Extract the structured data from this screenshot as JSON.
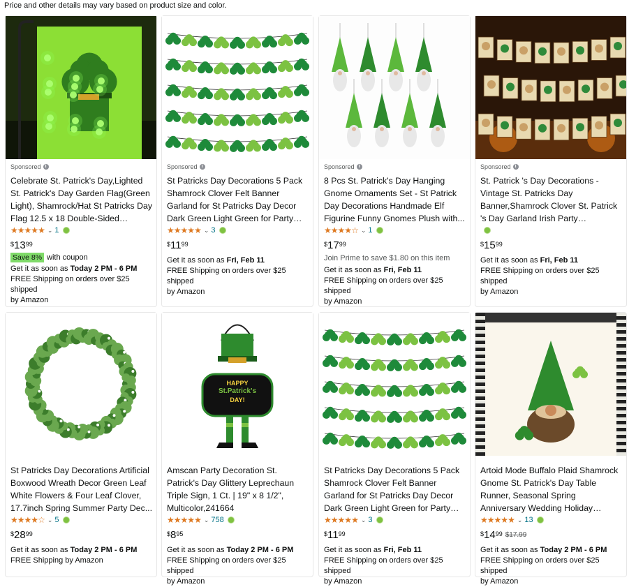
{
  "notice": "Price and other details may vary based on product size and color.",
  "sponsored_label": "Sponsored",
  "info_glyph": "i",
  "star_glyph": "★",
  "chevron_glyph": "⌄",
  "products": [
    {
      "sponsored": true,
      "title": "Celebrate St. Patrick's Day,Lighted St. Patrick's Day Garden Flag(Green Light), Shamrock/Hat St Patricks Day Flag 12.5 x 18 Double-Sided Displa...",
      "rating": 5,
      "rating_count": "1",
      "prime": true,
      "price_currency": "$",
      "price_whole": "13",
      "price_fraction": "99",
      "was_price": "",
      "coupon_badge": "Save 8%",
      "coupon_text": "with coupon",
      "extra_line": "",
      "delivery_prefix": "Get it as soon as ",
      "delivery_date": "Today 2 PM - 6 PM",
      "shipping": "FREE Shipping on orders over $25 shipped",
      "shipping_by": "by Amazon",
      "image_kind": "flag"
    },
    {
      "sponsored": true,
      "title": "St Patricks Day Decorations 5 Pack Shamrock Clover Felt Banner Garland for St Patricks Day Decor Dark Green Light Green for Party Home Store",
      "rating": 5,
      "rating_count": "3",
      "prime": true,
      "price_currency": "$",
      "price_whole": "11",
      "price_fraction": "99",
      "was_price": "",
      "coupon_badge": "",
      "coupon_text": "",
      "extra_line": "",
      "delivery_prefix": "Get it as soon as ",
      "delivery_date": "Fri, Feb 11",
      "shipping": "FREE Shipping on orders over $25 shipped",
      "shipping_by": "by Amazon",
      "image_kind": "garland"
    },
    {
      "sponsored": true,
      "title": "8 Pcs St. Patrick's Day Hanging Gnome Ornaments Set - St Patrick Day Decorations Handmade Elf Figurine Funny Gnomes Plush with...",
      "rating": 3.5,
      "rating_count": "1",
      "prime": true,
      "price_currency": "$",
      "price_whole": "17",
      "price_fraction": "99",
      "was_price": "",
      "coupon_badge": "",
      "coupon_text": "",
      "extra_line": "Join Prime to save $1.80 on this item",
      "delivery_prefix": "Get it as soon as ",
      "delivery_date": "Fri, Feb 11",
      "shipping": "FREE Shipping on orders over $25 shipped",
      "shipping_by": "by Amazon",
      "image_kind": "gnomes"
    },
    {
      "sponsored": true,
      "title": "St. Patrick 's Day Decorations - Vintage St. Patricks Day Banner,Shamrock Clover St. Patrick 's Day Garland Irish Party Supplies,...",
      "rating": 0,
      "rating_count": "",
      "prime": true,
      "price_currency": "$",
      "price_whole": "15",
      "price_fraction": "99",
      "was_price": "",
      "coupon_badge": "",
      "coupon_text": "",
      "extra_line": "",
      "delivery_prefix": "Get it as soon as ",
      "delivery_date": "Fri, Feb 11",
      "shipping": "FREE Shipping on orders over $25 shipped",
      "shipping_by": "by Amazon",
      "image_kind": "vintage"
    },
    {
      "sponsored": false,
      "title": "St Patricks Day Decorations Artificial Boxwood Wreath Decor Green Leaf White Flowers & Four Leaf Clover, 17.7inch Spring Summer Party Dec...",
      "rating": 3.5,
      "rating_count": "5",
      "prime": true,
      "price_currency": "$",
      "price_whole": "28",
      "price_fraction": "99",
      "was_price": "",
      "coupon_badge": "",
      "coupon_text": "",
      "extra_line": "",
      "delivery_prefix": "Get it as soon as ",
      "delivery_date": "Today 2 PM - 6 PM",
      "shipping": "FREE Shipping by Amazon",
      "shipping_by": "",
      "image_kind": "wreath"
    },
    {
      "sponsored": false,
      "title": "Amscan Party Decoration St. Patrick's Day Glittery Leprechaun Triple Sign, 1 Ct. | 19\" x 8 1/2\", Multicolor,241664",
      "rating": 4.5,
      "rating_count": "758",
      "prime": true,
      "price_currency": "$",
      "price_whole": "8",
      "price_fraction": "95",
      "was_price": "",
      "coupon_badge": "",
      "coupon_text": "",
      "extra_line": "",
      "delivery_prefix": "Get it as soon as ",
      "delivery_date": "Today 2 PM - 6 PM",
      "shipping": "FREE Shipping on orders over $25 shipped",
      "shipping_by": "by Amazon",
      "image_kind": "sign",
      "sign_text1": "HAPPY",
      "sign_text2": "St.Patrick's",
      "sign_text3": "DAY!"
    },
    {
      "sponsored": false,
      "title": "St Patricks Day Decorations 5 Pack Shamrock Clover Felt Banner Garland for St Patricks Day Decor Dark Green Light Green for Party Home Store",
      "rating": 5,
      "rating_count": "3",
      "prime": true,
      "price_currency": "$",
      "price_whole": "11",
      "price_fraction": "99",
      "was_price": "",
      "coupon_badge": "",
      "coupon_text": "",
      "extra_line": "",
      "delivery_prefix": "Get it as soon as ",
      "delivery_date": "Fri, Feb 11",
      "shipping": "FREE Shipping on orders over $25 shipped",
      "shipping_by": "by Amazon",
      "image_kind": "garland"
    },
    {
      "sponsored": false,
      "title": "Artoid Mode Buffalo Plaid Shamrock Gnome St. Patrick's Day Table Runner, Seasonal Spring Anniversary Wedding Holiday Kitchen Dining...",
      "rating": 5,
      "rating_count": "13",
      "prime": true,
      "price_currency": "$",
      "price_whole": "14",
      "price_fraction": "99",
      "was_price": "$17.99",
      "coupon_badge": "",
      "coupon_text": "",
      "extra_line": "",
      "delivery_prefix": "Get it as soon as ",
      "delivery_date": "Today 2 PM - 6 PM",
      "shipping": "FREE Shipping on orders over $25 shipped",
      "shipping_by": "by Amazon",
      "image_kind": "runner"
    }
  ],
  "colors": {
    "star": "#de7921",
    "link": "#007185",
    "prime_check": "#7fc241",
    "coupon_bg": "#7fda69",
    "shamrock_dark": "#1e8a3a",
    "shamrock_light": "#7cc242"
  }
}
